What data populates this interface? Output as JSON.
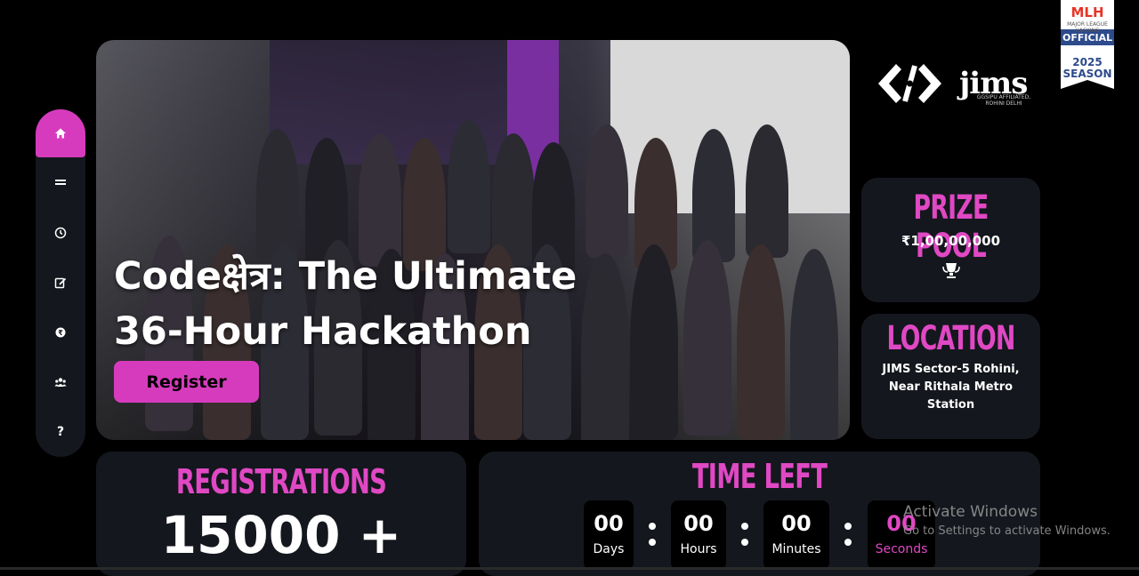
{
  "sidebar": {
    "items": [
      {
        "icon": "home-icon",
        "active": true
      },
      {
        "icon": "menu-icon"
      },
      {
        "icon": "clock-icon"
      },
      {
        "icon": "edit-icon"
      },
      {
        "icon": "sponsor-icon"
      },
      {
        "icon": "team-icon"
      },
      {
        "icon": "help-icon",
        "label": "?"
      }
    ]
  },
  "hero": {
    "title_line1": "Codeक्षेत्र: The Ultimate",
    "title_line2": "36-Hour Hackathon",
    "register_label": "Register"
  },
  "logos": {
    "jims": "jims",
    "jims_sub": "GGSIPU AFFILIATED, ROHINI DELHI",
    "mlh": "MLH",
    "mlh_official": "OFFICIAL",
    "mlh_season": "2025 SEASON",
    "mlh_tagline": "MAJOR LEAGUE HACKING"
  },
  "prize": {
    "heading": "PRIZE POOL",
    "value": "₹1,00,00,000"
  },
  "location": {
    "heading": "LOCATION",
    "text": "JIMS Sector-5 Rohini, Near Rithala Metro Station"
  },
  "registrations": {
    "heading": "REGISTRATIONS",
    "count": "15000 +"
  },
  "timer": {
    "heading": "TIME LEFT",
    "days": "00",
    "days_label": "Days",
    "hours": "00",
    "hours_label": "Hours",
    "minutes": "00",
    "minutes_label": "Minutes",
    "seconds": "00",
    "seconds_label": "Seconds"
  },
  "watermark": {
    "line1": "Activate Windows",
    "line2": "Go to Settings to activate Windows."
  },
  "colors": {
    "accent": "#d63bbd",
    "heading": "#e048c4",
    "card": "#14171d"
  }
}
